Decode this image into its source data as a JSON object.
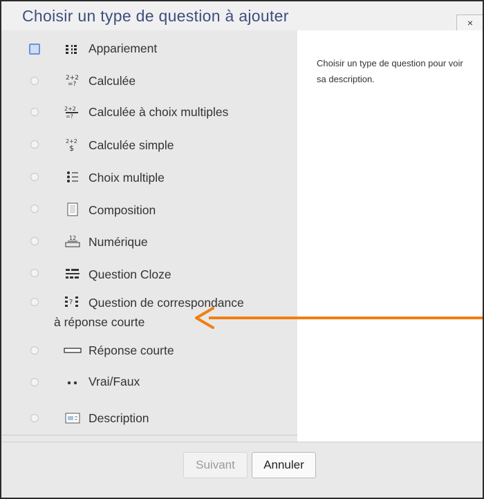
{
  "dialog": {
    "title": "Choisir un type de question à ajouter",
    "close_label": "×"
  },
  "options": [
    {
      "label": "Appariement",
      "icon": "matching-icon",
      "selected": true
    },
    {
      "label": "Calculée",
      "icon": "calculated-icon"
    },
    {
      "label": "Calculée à choix multiples",
      "icon": "calculated-multichoice-icon"
    },
    {
      "label": "Calculée simple",
      "icon": "calculated-simple-icon"
    },
    {
      "label": "Choix multiple",
      "icon": "multiple-choice-icon"
    },
    {
      "label": "Composition",
      "icon": "essay-icon"
    },
    {
      "label": "Numérique",
      "icon": "numerical-icon"
    },
    {
      "label": "Question Cloze",
      "icon": "cloze-icon"
    },
    {
      "label": "Question de correspondance",
      "label2": "à réponse courte",
      "icon": "random-short-answer-matching-icon"
    },
    {
      "label": "Réponse courte",
      "icon": "short-answer-icon"
    },
    {
      "label": "Vrai/Faux",
      "icon": "true-false-icon"
    },
    {
      "label": "Description",
      "icon": "description-icon"
    }
  ],
  "description_panel": {
    "text": "Choisir un type de question pour voir sa description."
  },
  "buttons": {
    "next_label": "Suivant",
    "cancel_label": "Annuler"
  },
  "colors": {
    "title": "#3d4f7d",
    "arrow": "#f07f12",
    "selected_radio": "#6b93d6"
  }
}
